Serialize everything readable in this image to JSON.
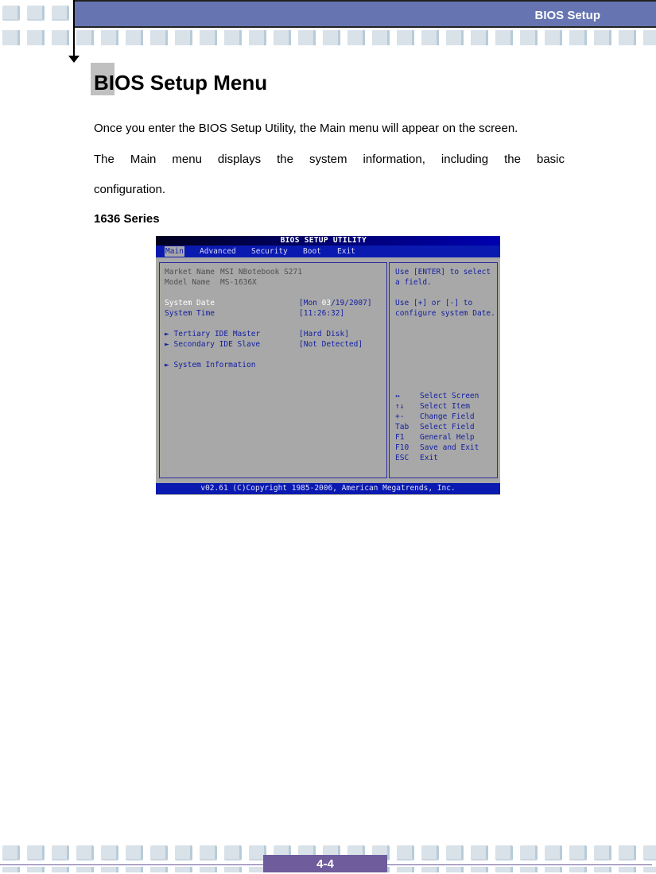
{
  "header": {
    "section_title": "BIOS Setup"
  },
  "page": {
    "title": "BIOS Setup Menu",
    "paragraphs": [
      "Once you enter the BIOS Setup Utility, the Main menu will appear on the screen.",
      "The Main menu displays the system information, including the basic",
      "configuration."
    ],
    "subheading": "1636 Series"
  },
  "bios": {
    "title": "BIOS SETUP UTILITY",
    "tabs": [
      {
        "label": "Main",
        "active": true
      },
      {
        "label": "Advanced"
      },
      {
        "label": "Security"
      },
      {
        "label": "Boot"
      },
      {
        "label": "Exit"
      }
    ],
    "info": [
      {
        "label": "Market Name",
        "value": "MSI NBotebook S271"
      },
      {
        "label": "Model Name",
        "value": "MS-1636X"
      }
    ],
    "settings": [
      {
        "label": "System Date",
        "value_prefix": "[Mon ",
        "value_highlight": "03",
        "value_suffix": "/19/2007]"
      },
      {
        "label": "System Time",
        "value": "[11:26:32]"
      }
    ],
    "submenus": [
      {
        "label": "Tertiary IDE Master",
        "value": "[Hard Disk]"
      },
      {
        "label": "Secondary IDE Slave",
        "value": "[Not Detected]"
      },
      {
        "label": "System Information"
      }
    ],
    "submenu_marker": "►",
    "help": {
      "line1": "Use [ENTER] to select",
      "line2": "a field.",
      "line3": "Use [+] or [-] to",
      "line4": "configure system Date."
    },
    "keys": [
      {
        "key": "↔",
        "action": "Select Screen"
      },
      {
        "key": "↑↓",
        "action": "Select Item"
      },
      {
        "key": "+-",
        "action": "Change Field"
      },
      {
        "key": "Tab",
        "action": "Select Field"
      },
      {
        "key": "F1",
        "action": "General Help"
      },
      {
        "key": "F10",
        "action": "Save and Exit"
      },
      {
        "key": "ESC",
        "action": "Exit"
      }
    ],
    "footer": "v02.61 (C)Copyright 1985-2006, American Megatrends, Inc."
  },
  "footer": {
    "page_number": "4-4"
  }
}
